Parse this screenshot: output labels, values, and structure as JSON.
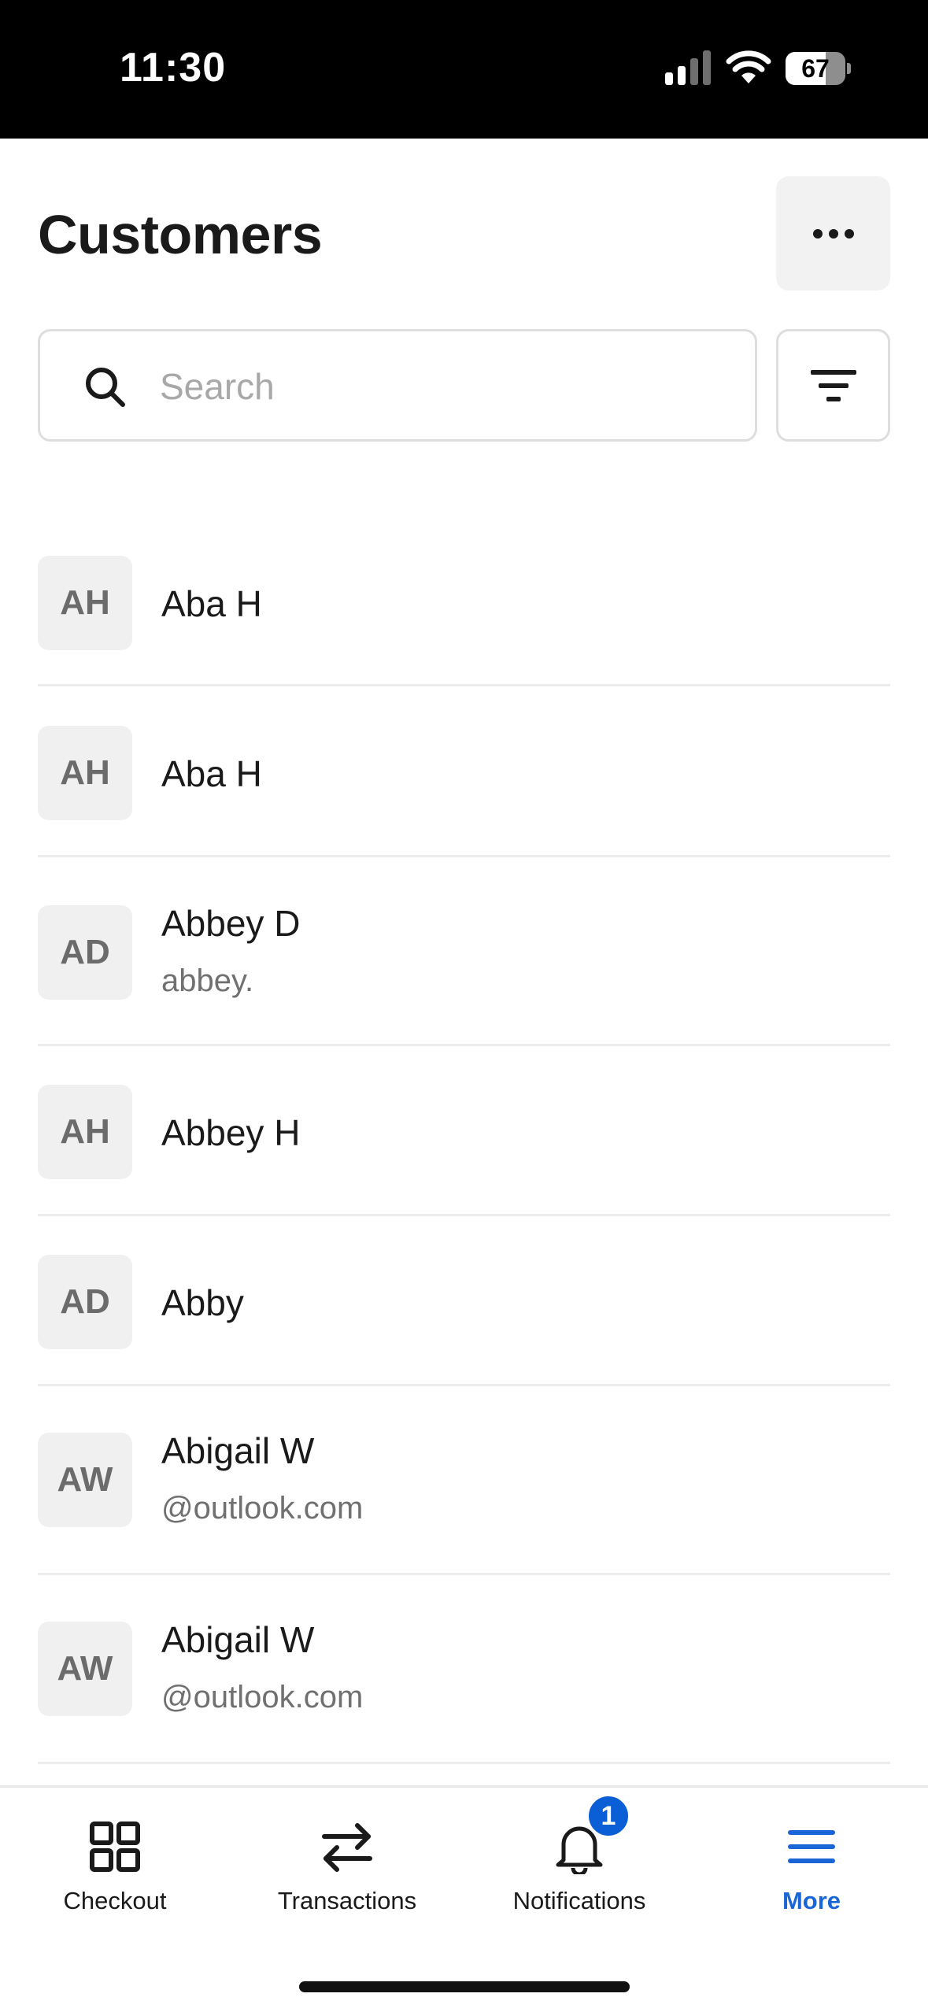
{
  "status_bar": {
    "time": "11:30",
    "battery_level": "67",
    "battery_fraction": 0.67,
    "icons": [
      "cellular-signal-icon",
      "wifi-icon",
      "battery-icon"
    ]
  },
  "header": {
    "title": "Customers",
    "more_icon": "ellipsis-icon"
  },
  "search": {
    "placeholder": "Search",
    "value": "",
    "icon": "search-icon",
    "filter_icon": "filter-icon"
  },
  "customers": [
    {
      "initials": "AH",
      "name": "Aba H",
      "email": ""
    },
    {
      "initials": "AH",
      "name": "Aba H",
      "email": ""
    },
    {
      "initials": "AD",
      "name": "Abbey D",
      "email": "abbey."
    },
    {
      "initials": "AH",
      "name": "Abbey H",
      "email": ""
    },
    {
      "initials": "AD",
      "name": "Abby",
      "email": ""
    },
    {
      "initials": "AW",
      "name": "Abigail W",
      "email": "@outlook.com"
    },
    {
      "initials": "AW",
      "name": "Abigail W",
      "email": "@outlook.com"
    }
  ],
  "tab_bar": {
    "tabs": [
      {
        "label": "Checkout",
        "icon": "grid-icon"
      },
      {
        "label": "Transactions",
        "icon": "arrows-swap-icon"
      },
      {
        "label": "Notifications",
        "icon": "bell-icon"
      },
      {
        "label": "More",
        "icon": "menu-icon"
      }
    ],
    "notifications_badge": "1",
    "active_tab": "More"
  },
  "colors": {
    "accent": "#1a66d6",
    "badge": "#0b5fd6",
    "avatar_bg": "#f0f0f0",
    "text_primary": "#1a1a1a",
    "text_secondary": "#707070"
  }
}
